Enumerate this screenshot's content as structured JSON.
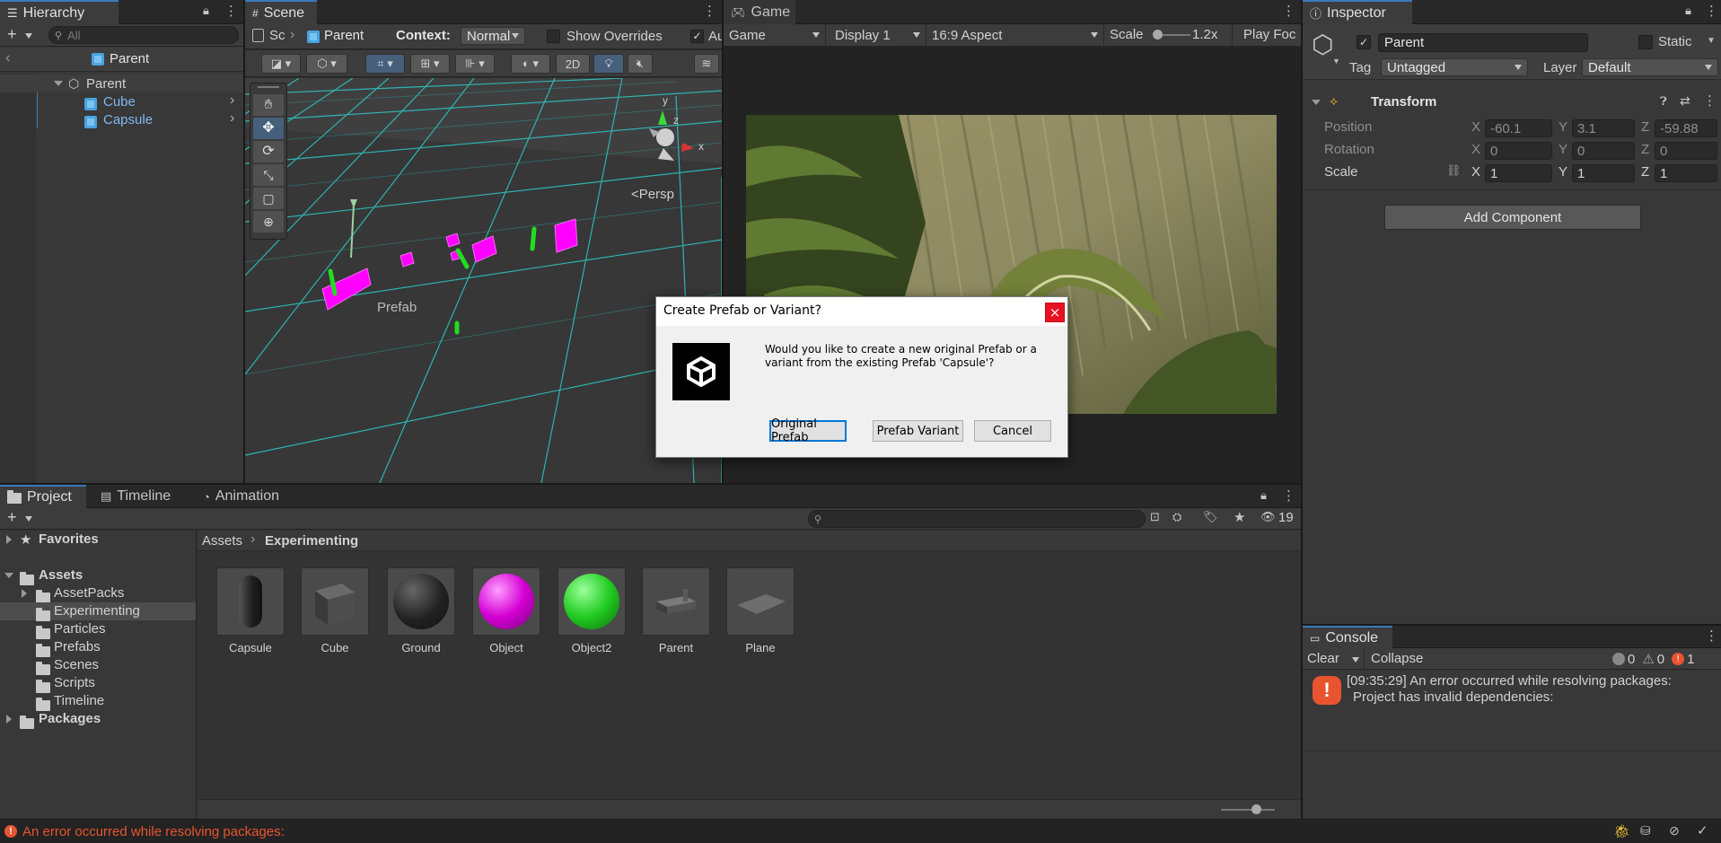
{
  "hierarchy": {
    "tab": "Hierarchy",
    "search_placeholder": "All",
    "scene_root": "Parent",
    "items": [
      {
        "label": "Parent"
      },
      {
        "label": "Cube"
      },
      {
        "label": "Capsule"
      }
    ]
  },
  "scene": {
    "tab": "Scene",
    "breadcrumb_scene": "Sc",
    "breadcrumb_object": "Parent",
    "context_label": "Context:",
    "context_value": "Normal",
    "show_overrides": "Show Overrides",
    "auto_label": "Au",
    "btn_2d": "2D",
    "persp_label": "<Persp",
    "prefab_label": "Prefab",
    "gizmo_axes": {
      "x": "x",
      "y": "y",
      "z": "z"
    }
  },
  "game": {
    "tab": "Game",
    "mode": "Game",
    "display": "Display 1",
    "aspect": "16:9 Aspect",
    "scale_label": "Scale",
    "scale_value": "1.2x",
    "play_focus": "Play Foc"
  },
  "dialog": {
    "title": "Create Prefab or Variant?",
    "message": "Would you like to create a new original Prefab or a variant from the existing Prefab 'Capsule'?",
    "btn_original": "Original Prefab",
    "btn_variant": "Prefab Variant",
    "btn_cancel": "Cancel",
    "close_glyph": "×"
  },
  "inspector": {
    "tab": "Inspector",
    "object_name": "Parent",
    "static_label": "Static",
    "tag_label": "Tag",
    "tag_value": "Untagged",
    "layer_label": "Layer",
    "layer_value": "Default",
    "transform_title": "Transform",
    "position_label": "Position",
    "rotation_label": "Rotation",
    "scale_label": "Scale",
    "position": {
      "x": "-60.1",
      "y": "3.1",
      "z": "-59.88"
    },
    "rotation": {
      "x": "0",
      "y": "0",
      "z": "0"
    },
    "scale": {
      "x": "1",
      "y": "1",
      "z": "1"
    },
    "add_component": "Add Component"
  },
  "project": {
    "tabs": [
      "Project",
      "Timeline",
      "Animation"
    ],
    "hidden_count": "19",
    "breadcrumb_root": "Assets",
    "breadcrumb_current": "Experimenting",
    "tree": {
      "favorites": "Favorites",
      "assets": "Assets",
      "folders": [
        "AssetPacks",
        "Experimenting",
        "Particles",
        "Prefabs",
        "Scenes",
        "Scripts",
        "Timeline"
      ],
      "packages": "Packages"
    },
    "assets": [
      "Capsule",
      "Cube",
      "Ground",
      "Object",
      "Object2",
      "Parent",
      "Plane"
    ]
  },
  "console": {
    "tab": "Console",
    "clear": "Clear",
    "collapse": "Collapse",
    "counts": {
      "info": "0",
      "warn": "0",
      "error": "1"
    },
    "message_line1": "[09:35:29] An error occurred while resolving packages:",
    "message_line2": "Project has invalid dependencies:"
  },
  "statusbar": {
    "message": "An error occurred while resolving packages:"
  },
  "colors": {
    "accent": "#3a79bb",
    "error": "#e8542f",
    "magenta": "#ff00ff",
    "green": "#22cc22"
  }
}
